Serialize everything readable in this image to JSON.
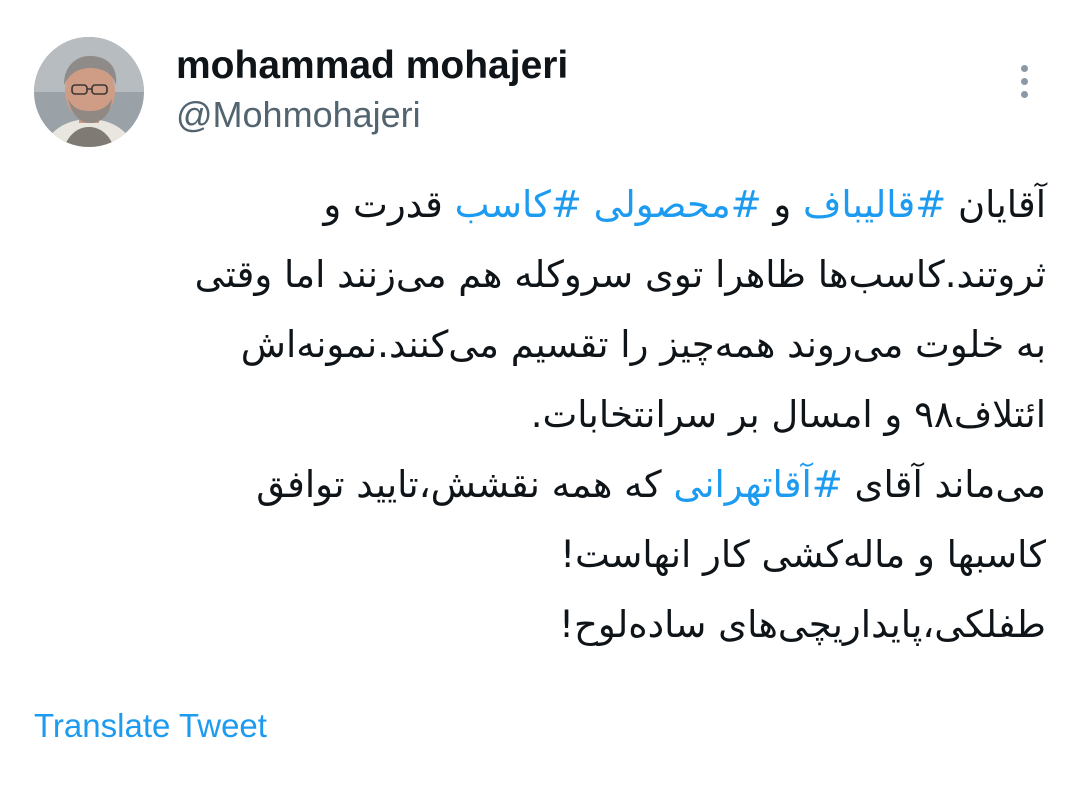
{
  "author": {
    "display_name": "mohammad mohajeri",
    "handle": "@Mohmohajeri"
  },
  "icons": {
    "more": "more-vertical-icon",
    "avatar": "profile-photo"
  },
  "colors": {
    "text": "#0f1419",
    "secondary_text": "#536471",
    "link": "#1d9bf0",
    "background": "#ffffff"
  },
  "tweet": {
    "lines": [
      [
        {
          "text": "آقایان ",
          "hashtag": false
        },
        {
          "text": "#قالیباف",
          "hashtag": true
        },
        {
          "text": " و ",
          "hashtag": false
        },
        {
          "text": "#محصولی",
          "hashtag": true
        },
        {
          "text": " ",
          "hashtag": false
        },
        {
          "text": "#کاسب",
          "hashtag": true
        },
        {
          "text": " قدرت و",
          "hashtag": false
        }
      ],
      [
        {
          "text": "ثروتند.کاسب‌ها ظاهرا توی سروکله هم می‌زنند اما وقتی",
          "hashtag": false
        }
      ],
      [
        {
          "text": "به خلوت می‌روند همه‌چیز را تقسیم می‌کنند.نمونه‌اش",
          "hashtag": false
        }
      ],
      [
        {
          "text": "ائتلاف۹۸ و امسال بر سرانتخابات.",
          "hashtag": false
        }
      ],
      [
        {
          "text": "می‌ماند آقای ",
          "hashtag": false
        },
        {
          "text": "#آقاتهرانی",
          "hashtag": true
        },
        {
          "text": " که همه نقشش،تایید توافق",
          "hashtag": false
        }
      ],
      [
        {
          "text": "کاسبها و ماله‌کشی کار انهاست!",
          "hashtag": false
        }
      ],
      [
        {
          "text": "طفلکی،پایداریچی‌های ساده‌لوح!",
          "hashtag": false
        }
      ]
    ]
  },
  "actions": {
    "translate_label": "Translate Tweet"
  }
}
